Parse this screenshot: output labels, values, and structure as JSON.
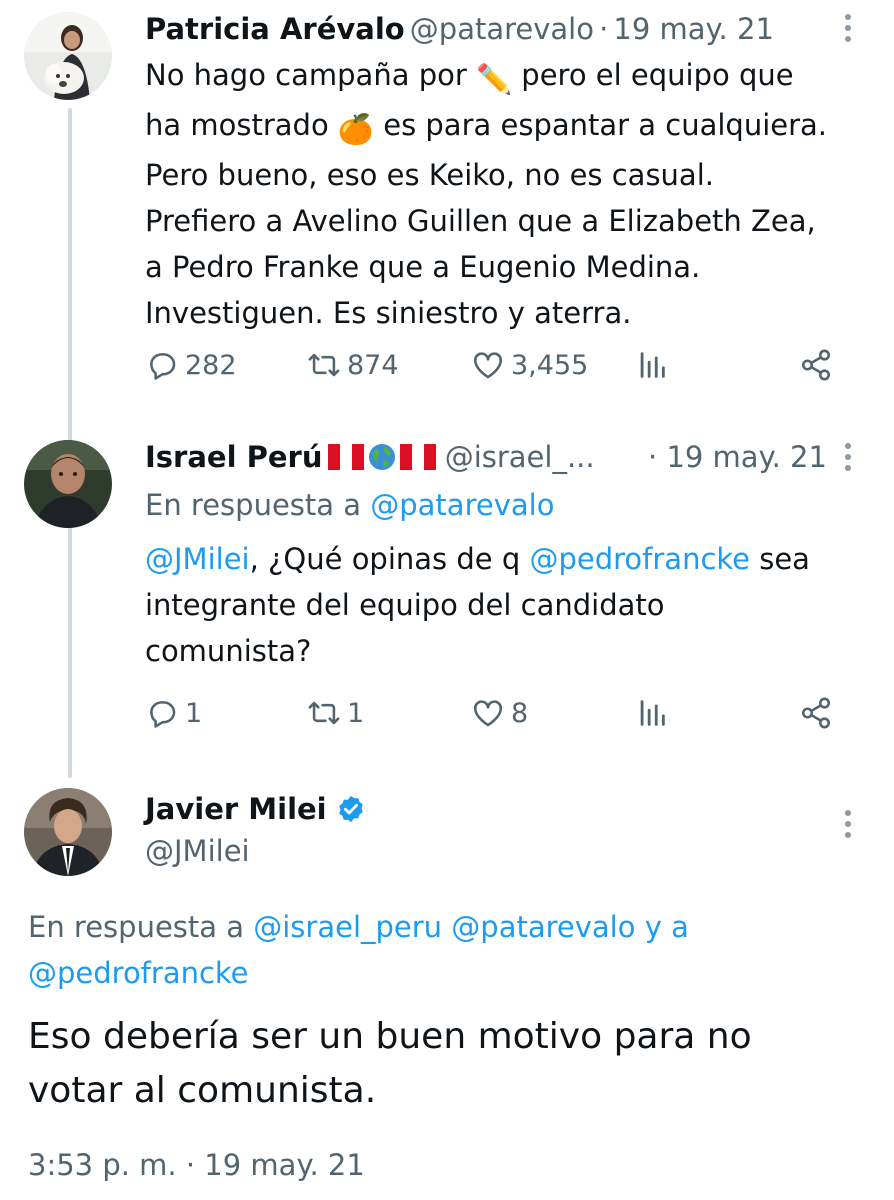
{
  "tweet1": {
    "author_name": "Patricia Arévalo",
    "handle": "@patarevalo",
    "separator": "·",
    "date": "19 may. 21",
    "text_part1": "No hago campaña por ",
    "text_part2": " pero el equipo que",
    "text_line2_part1": "ha mostrado ",
    "text_line2_part2": " es para espantar a cualquiera.",
    "text_line3": "Pero bueno, eso es Keiko, no es casual.",
    "text_line4": "Prefiero a Avelino Guillen que a Elizabeth Zea,",
    "text_line5": "a Pedro Franke que a Eugenio Medina.",
    "text_line6": "Investiguen. Es siniestro y aterra.",
    "emoji_pencil": "✏️",
    "emoji_orange": "🍊",
    "replies": "282",
    "retweets": "874",
    "likes": "3,455"
  },
  "tweet2": {
    "author_name": "Israel Perú",
    "handle": "@israel_...",
    "separator": "·",
    "date": "19 may. 21",
    "reply_prefix": "En respuesta a ",
    "reply_to": "@patarevalo",
    "mention1": "@JMilei",
    "text_part1": ", ¿Qué opinas de q ",
    "mention2": "@pedrofrancke",
    "text_part2": " sea",
    "text_line2": "integrante del equipo del candidato",
    "text_line3": "comunista?",
    "replies": "1",
    "retweets": "1",
    "likes": "8"
  },
  "tweet3": {
    "author_name": "Javier Milei",
    "handle": "@JMilei",
    "reply_prefix": "En respuesta a ",
    "reply_to_1": "@israel_peru",
    "reply_to_2": "@patarevalo",
    "reply_and": "y a",
    "reply_to_3": "@pedrofrancke",
    "text_line1": "Eso debería ser un buen motivo para no",
    "text_line2": "votar al comunista.",
    "timestamp": "3:53 p. m. · 19 may. 21"
  },
  "icons": [
    "reply-icon",
    "retweet-icon",
    "like-icon",
    "views-icon",
    "share-icon",
    "more-icon",
    "verified-badge-icon",
    "peru-flag-icon",
    "globe-icon"
  ],
  "colors": {
    "link": "#1d9bf0",
    "secondary": "#536471",
    "thread_line": "#cfd9de",
    "verified": "#1d9bf0"
  }
}
